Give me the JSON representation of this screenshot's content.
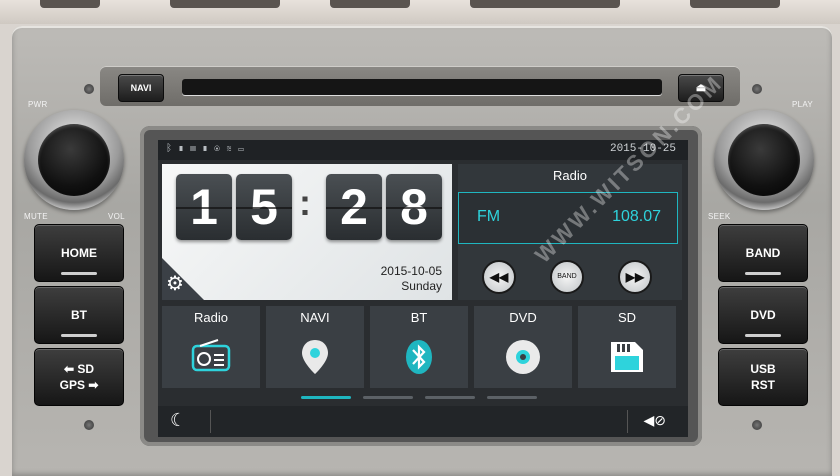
{
  "hardware": {
    "navi_button": "NAVI",
    "eject_icon": "eject-icon",
    "pwr_label": "PWR",
    "mute_label": "MUTE",
    "vol_label": "VOL",
    "play_label": "PLAY",
    "seek_label": "SEEK",
    "left_buttons": [
      "HOME",
      "BT",
      "SD",
      "GPS"
    ],
    "right_buttons": [
      "BAND",
      "DVD",
      "USB",
      "RST"
    ]
  },
  "status_bar": {
    "icons": [
      "bluetooth-icon",
      "battery-icon",
      "sd-card-icon",
      "usb-icon",
      "disc-icon",
      "wifi-icon",
      "card-icon"
    ],
    "date": "2015-10-25"
  },
  "clock": {
    "digits": [
      "1",
      "5",
      "2",
      "8"
    ],
    "separator": ":",
    "date": "2015-10-05",
    "weekday": "Sunday"
  },
  "radio": {
    "title": "Radio",
    "band": "FM",
    "frequency": "108.07",
    "band_button": "BAND"
  },
  "tiles": [
    {
      "label": "Radio",
      "icon": "radio-icon"
    },
    {
      "label": "NAVI",
      "icon": "map-pin-icon"
    },
    {
      "label": "BT",
      "icon": "bluetooth-icon"
    },
    {
      "label": "DVD",
      "icon": "disc-icon"
    },
    {
      "label": "SD",
      "icon": "sd-card-icon"
    }
  ],
  "pager": {
    "pages": 4,
    "active": 1
  },
  "watermark": "WWW.WITSON.COM",
  "colors": {
    "accent": "#1fb6c0",
    "tile": "#3a3f44",
    "panel": "#32373b"
  }
}
